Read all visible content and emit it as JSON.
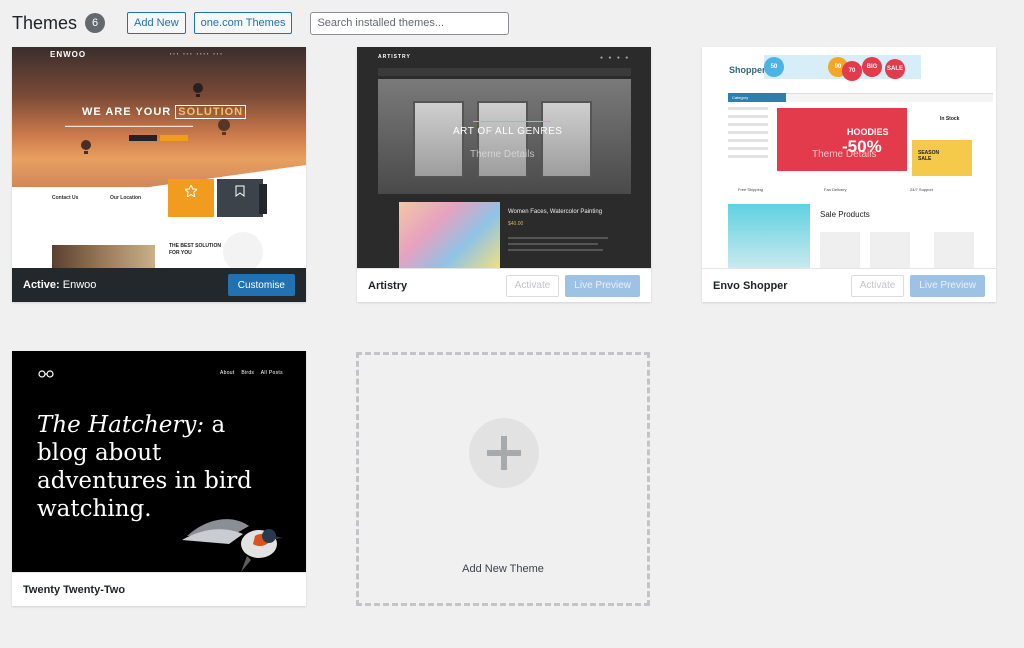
{
  "header": {
    "title": "Themes",
    "count": "6",
    "add_new_label": "Add New",
    "onecom_label": "one.com Themes",
    "search_placeholder": "Search installed themes..."
  },
  "themes": [
    {
      "name": "Enwoo",
      "active_prefix": "Active:",
      "customise_label": "Customise",
      "preview": {
        "logo": "ENWOO",
        "headline_pre": "WE ARE YOUR ",
        "headline_hl": "SOLUTION",
        "contact": "Contact Us",
        "location": "Our Location",
        "about_1": "THE BEST SOLUTION",
        "about_2": "FOR YOU"
      }
    },
    {
      "name": "Artistry",
      "activate_label": "Activate",
      "live_preview_label": "Live Preview",
      "preview": {
        "logo": "ARTISTRY",
        "hero_title": "ART OF ALL GENRES",
        "overlay": "Theme Details",
        "product_title": "Women Faces, Watercolor Painting",
        "price": "$40.00"
      }
    },
    {
      "name": "Envo Shopper",
      "activate_label": "Activate",
      "live_preview_label": "Live Preview",
      "preview": {
        "logo": "Shopper",
        "category": "Category",
        "hoodies": "HOODIES",
        "discount": "-50%",
        "overlay": "Theme Details",
        "in_stock": "In Stock",
        "season_sale_1": "SEASON",
        "season_sale_2": "SALE",
        "free_shipping": "Free Shipping",
        "fan_delivery": "Fan Delivery",
        "support": "24/7 Support",
        "sale_products": "Sale Products",
        "big": "BIG",
        "sale": "SALE",
        "pct_90": "90",
        "pct_70": "70",
        "pct_50": "50"
      }
    },
    {
      "name": "Twenty Twenty-Two",
      "preview": {
        "nav_about": "About",
        "nav_birds": "Birds",
        "nav_all_posts": "All Posts",
        "headline_italic": "The Hatchery:",
        "headline_rest": " a blog about adventures in bird watching."
      }
    }
  ],
  "add_new_theme_label": "Add New Theme",
  "colors": {
    "primary": "#2271b1",
    "active_bar": "#23282d",
    "background": "#f0f0f1"
  }
}
